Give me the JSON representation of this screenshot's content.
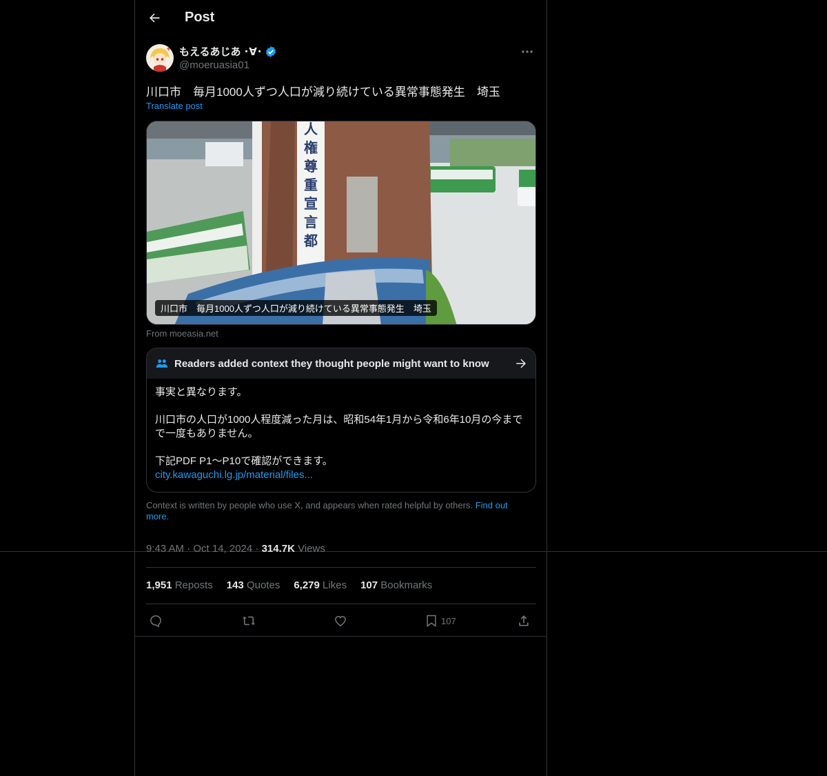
{
  "header": {
    "title": "Post"
  },
  "author": {
    "display_name": "もえるあじあ ･∀･",
    "handle": "@moeruasia01",
    "verified": true
  },
  "post": {
    "text": "川口市　毎月1000人ずつ人口が減り続けている異常事態発生　埼玉",
    "translate_label": "Translate post"
  },
  "link_card": {
    "caption": "川口市　毎月1000人ずつ人口が減り続けている異常事態発生　埼玉",
    "source": "From moeasia.net"
  },
  "community_note": {
    "heading": "Readers added context they thought people might want to know",
    "paragraphs": [
      "事実と異なります。",
      "川口市の人口が1000人程度減った月は、昭和54年1月から令和6年10月の今までで一度もありません。",
      "下記PDF P1〜P10で確認ができます。"
    ],
    "link": "city.kawaguchi.lg.jp/material/files...",
    "footer_text": "Context is written by people who use X, and appears when rated helpful by others.",
    "footer_link": "Find out more."
  },
  "meta": {
    "time": "9:43 AM · Oct 14, 2024 · ",
    "views_count": "314.7K",
    "views_label": " Views"
  },
  "stats": {
    "reposts_count": "1,951",
    "reposts_label": "Reposts",
    "quotes_count": "143",
    "quotes_label": "Quotes",
    "likes_count": "6,279",
    "likes_label": "Likes",
    "bookmarks_count": "107",
    "bookmarks_label": "Bookmarks"
  },
  "actions": {
    "bookmark_count": "107"
  },
  "colors": {
    "accent": "#1d9bf0",
    "text": "#e7e9ea",
    "muted": "#71767b",
    "border": "#2f3336"
  },
  "icons": [
    "back-arrow-icon",
    "verified-badge-icon",
    "more-icon",
    "people-icon",
    "arrow-right-icon",
    "reply-icon",
    "repost-icon",
    "like-icon",
    "bookmark-icon",
    "share-icon"
  ]
}
